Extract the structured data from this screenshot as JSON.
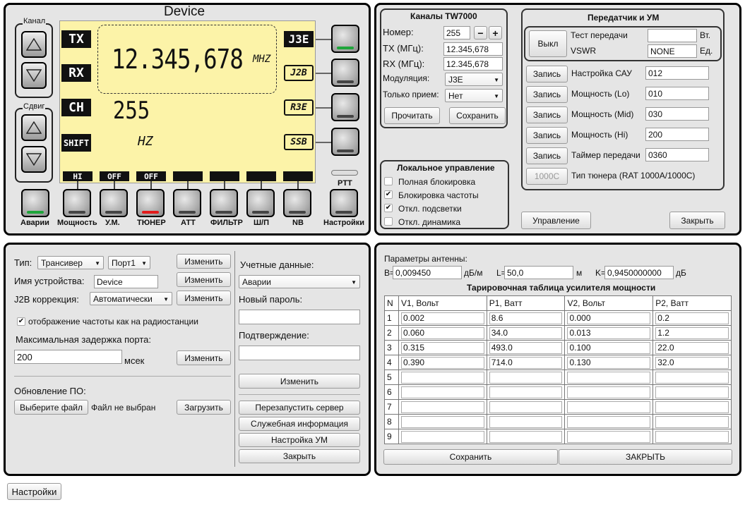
{
  "device": {
    "title": "Device",
    "canal_label": "Канал",
    "shift_label": "Сдвиг",
    "tags_left": [
      "TX",
      "RX",
      "CH",
      "SHIFT"
    ],
    "freq_main": "12.345,678",
    "freq_unit": "MHZ",
    "ch_value": "255",
    "hz_label": "HZ",
    "tags_right": [
      "J3E",
      "J2B",
      "R3E",
      "SSB"
    ],
    "status_tags": [
      "HI",
      "OFF",
      "OFF",
      "",
      "",
      "",
      ""
    ],
    "ptt_label": "PTT",
    "bottom_buttons": [
      "Аварии",
      "Мощность",
      "У.М.",
      "ТЮНЕР",
      "АТТ",
      "ФИЛЬТР",
      "Ш/П",
      "NB",
      "Настройки"
    ],
    "colors": {
      "lcd": "#fcf3a8",
      "green": "#1ea53a",
      "red": "#e21b1b"
    }
  },
  "channels": {
    "title": "Каналы TW7000",
    "number_label": "Номер:",
    "number_value": "255",
    "tx_label": "TX (МГц):",
    "tx_value": "12.345,678",
    "rx_label": "RX (МГц):",
    "rx_value": "12.345,678",
    "mod_label": "Модуляция:",
    "mod_value": "J3E",
    "rxonly_label": "Только прием:",
    "rxonly_value": "Нет",
    "read_btn": "Прочитать",
    "save_btn": "Сохранить"
  },
  "local": {
    "title": "Локальное управление",
    "items": [
      "Полная блокировка",
      "Блокировка частоты",
      "Откл. подсветки",
      "Откл. динамика"
    ],
    "checked": [
      false,
      true,
      true,
      false
    ]
  },
  "tx": {
    "title": "Передатчик и УМ",
    "off_btn": "Выкл",
    "test_label": "Тест передачи",
    "test_value": "",
    "test_unit": "Вт.",
    "vswr_label": "VSWR",
    "vswr_value": "NONE",
    "vswr_unit": "Ед.",
    "write_label": "Запись",
    "rows": [
      {
        "label": "Настройка САУ",
        "value": "012"
      },
      {
        "label": "Мощность (Lo)",
        "value": "010"
      },
      {
        "label": "Мощность (Mid)",
        "value": "030"
      },
      {
        "label": "Мощность (Hi)",
        "value": "200"
      },
      {
        "label": "Таймер передачи",
        "value": "0360"
      }
    ],
    "tuner_btn": "1000C",
    "tuner_label": "Тип тюнера (RAT 1000A/1000C)",
    "control_btn": "Управление",
    "close_btn": "Закрыть"
  },
  "settings": {
    "type_label": "Тип:",
    "type_value": "Трансивер",
    "port_value": "Порт1",
    "change": "Изменить",
    "name_label": "Имя устройства:",
    "name_value": "Device",
    "j2b_label": "J2B коррекция:",
    "j2b_value": "Автоматически",
    "freq_display": "отображение частоты как на радиостанции",
    "delay_label": "Максимальная задержка порта:",
    "delay_value": "200",
    "delay_unit": "мсек",
    "fw_label": "Обновление ПО:",
    "choose_file": "Выберите файл",
    "no_file": "Файл не выбран",
    "upload": "Загрузить",
    "cred_label": "Учетные данные:",
    "cred_value": "Аварии",
    "newpass_label": "Новый пароль:",
    "confirm_label": "Подтверждение:",
    "change_btn": "Изменить",
    "restart": "Перезапустить сервер",
    "service": "Служебная информация",
    "amp": "Настройка УМ",
    "close": "Закрыть"
  },
  "antenna": {
    "params_label": "Параметры антенны:",
    "b_label": "B=",
    "b_value": "0,009450",
    "b_unit": "дБ/м",
    "l_label": "L=",
    "l_value": "50,0",
    "l_unit": "м",
    "k_label": "K=",
    "k_value": "0,9450000000",
    "k_unit": "дБ",
    "table_title": "Тарировочная таблица усилителя мощности",
    "headers": [
      "N",
      "V1, Вольт",
      "P1, Ватт",
      "V2, Вольт",
      "P2, Ватт"
    ],
    "rows": [
      [
        "1",
        "0.002",
        "8.6",
        "0.000",
        "0.2"
      ],
      [
        "2",
        "0.060",
        "34.0",
        "0.013",
        "1.2"
      ],
      [
        "3",
        "0.315",
        "493.0",
        "0.100",
        "22.0"
      ],
      [
        "4",
        "0.390",
        "714.0",
        "0.130",
        "32.0"
      ],
      [
        "5",
        "",
        "",
        "",
        ""
      ],
      [
        "6",
        "",
        "",
        "",
        ""
      ],
      [
        "7",
        "",
        "",
        "",
        ""
      ],
      [
        "8",
        "",
        "",
        "",
        ""
      ],
      [
        "9",
        "",
        "",
        "",
        ""
      ]
    ],
    "save": "Сохранить",
    "close": "ЗАКРЫТЬ"
  },
  "footer": {
    "settings_btn": "Настройки"
  }
}
